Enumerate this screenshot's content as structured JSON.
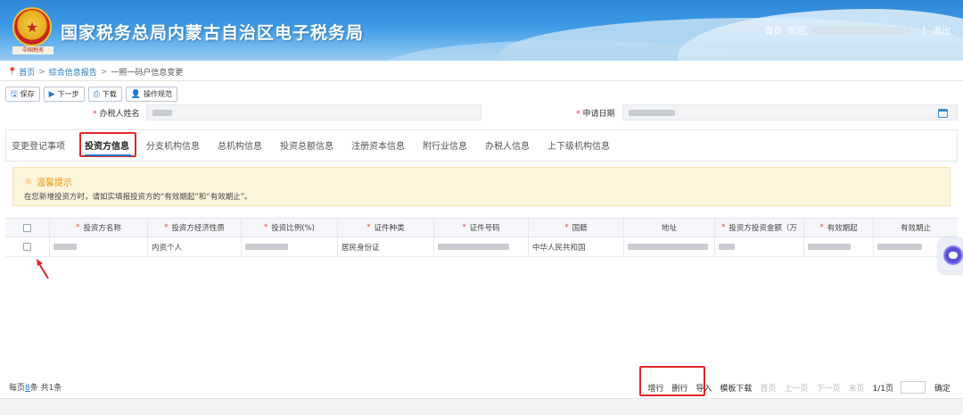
{
  "header": {
    "site_title": "国家税务总局内蒙古自治区电子税务局",
    "emblem_text": "中国税务",
    "home_link": "首页",
    "welcome_text": "欢迎,",
    "sep": "|",
    "logout_link": "退出"
  },
  "breadcrumb": {
    "home": "首页",
    "level1": "综合信息报告",
    "level2": "一照一码户信息变更",
    "sep": ">"
  },
  "toolbar": {
    "save": "保存",
    "next": "下一步",
    "download": "下载",
    "guide": "操作规范"
  },
  "form": {
    "req": "*",
    "handler_label": "办税人姓名",
    "date_label": "申请日期"
  },
  "tabs": [
    {
      "label": "变更登记事项"
    },
    {
      "label": "投资方信息"
    },
    {
      "label": "分支机构信息"
    },
    {
      "label": "总机构信息"
    },
    {
      "label": "投资总额信息"
    },
    {
      "label": "注册资本信息"
    },
    {
      "label": "附行业信息"
    },
    {
      "label": "办税人信息"
    },
    {
      "label": "上下级机构信息"
    }
  ],
  "notice": {
    "title": "温馨提示",
    "text": "在您新增投资方时，请如实填报投资方的“有效期起”和“有效期止”。"
  },
  "table": {
    "req": "*",
    "headers": [
      "投资方名称",
      "投资方经济性质",
      "投资比例(%)",
      "证件种类",
      "证件号码",
      "国籍",
      "地址",
      "投资方投资金额（万",
      "有效期起",
      "有效期止"
    ],
    "rows": [
      {
        "economic_nature": "内资个人",
        "id_type": "居民身份证",
        "nationality": "中华人民共和国"
      }
    ]
  },
  "pager": {
    "per_page_prefix": "每页",
    "per_page": "8",
    "per_page_suffix": "条 共1条",
    "add_row": "增行",
    "del_row": "删行",
    "import": "导入",
    "template_download": "模板下载",
    "first": "首页",
    "prev": "上一页",
    "next": "下一页",
    "last": "末页",
    "page_info": "1/1页",
    "confirm": "确定"
  },
  "colors": {
    "primary": "#1e78c8",
    "highlight_red": "#e0262b",
    "notice_bg": "#fdf4dc",
    "notice_title": "#e59a12"
  }
}
